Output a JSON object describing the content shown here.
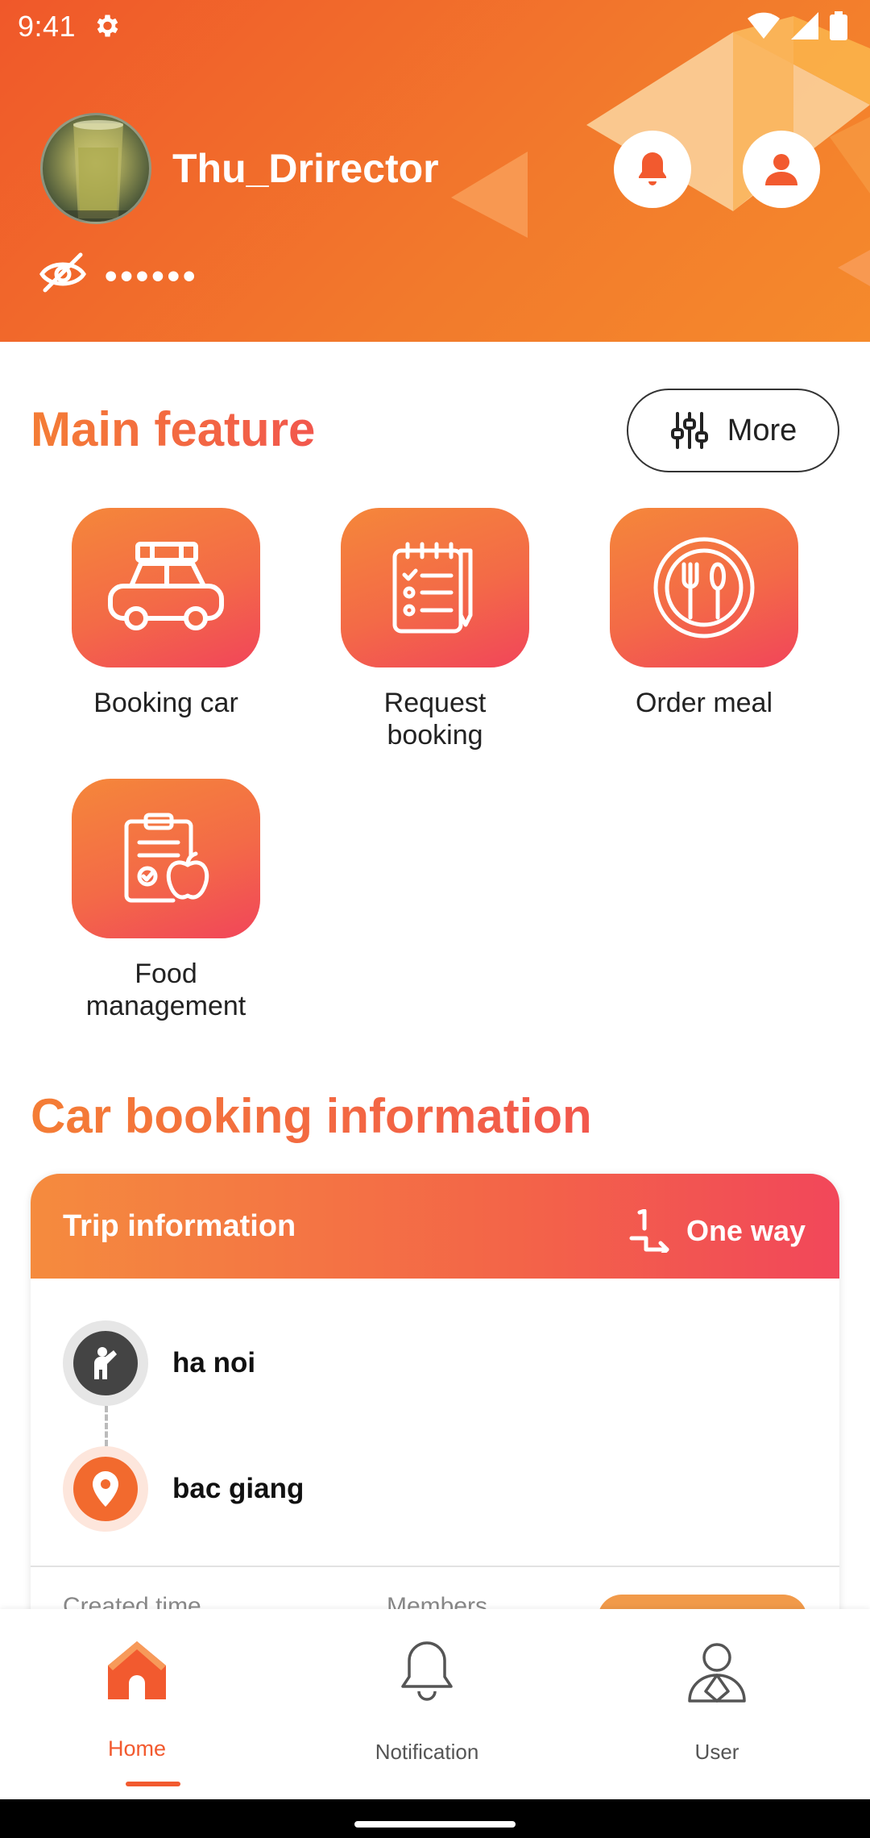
{
  "status_bar": {
    "time": "9:41"
  },
  "header": {
    "user_name": "Thu_Drirector",
    "masked_balance": "••••••"
  },
  "main_feature": {
    "title": "Main feature",
    "more_label": "More",
    "items": [
      {
        "label": "Booking car",
        "icon": "car-icon"
      },
      {
        "label": "Request booking",
        "icon": "clipboard-list-icon"
      },
      {
        "label": "Order meal",
        "icon": "plate-cutlery-icon"
      },
      {
        "label": "Food management",
        "icon": "clipboard-apple-icon"
      }
    ]
  },
  "car_booking": {
    "title": "Car booking information",
    "trip": {
      "title": "Trip information",
      "type": "One way",
      "from": "ha noi",
      "to": "bac giang",
      "created_label": "Created time",
      "members_label": "Members"
    }
  },
  "bottom_nav": {
    "items": [
      {
        "label": "Home",
        "icon": "home-icon",
        "active": true
      },
      {
        "label": "Notification",
        "icon": "bell-icon",
        "active": false
      },
      {
        "label": "User",
        "icon": "user-icon",
        "active": false
      }
    ]
  },
  "colors": {
    "accent": "#f25a2f",
    "gradient_start": "#f5873a",
    "gradient_end": "#f2455a"
  }
}
